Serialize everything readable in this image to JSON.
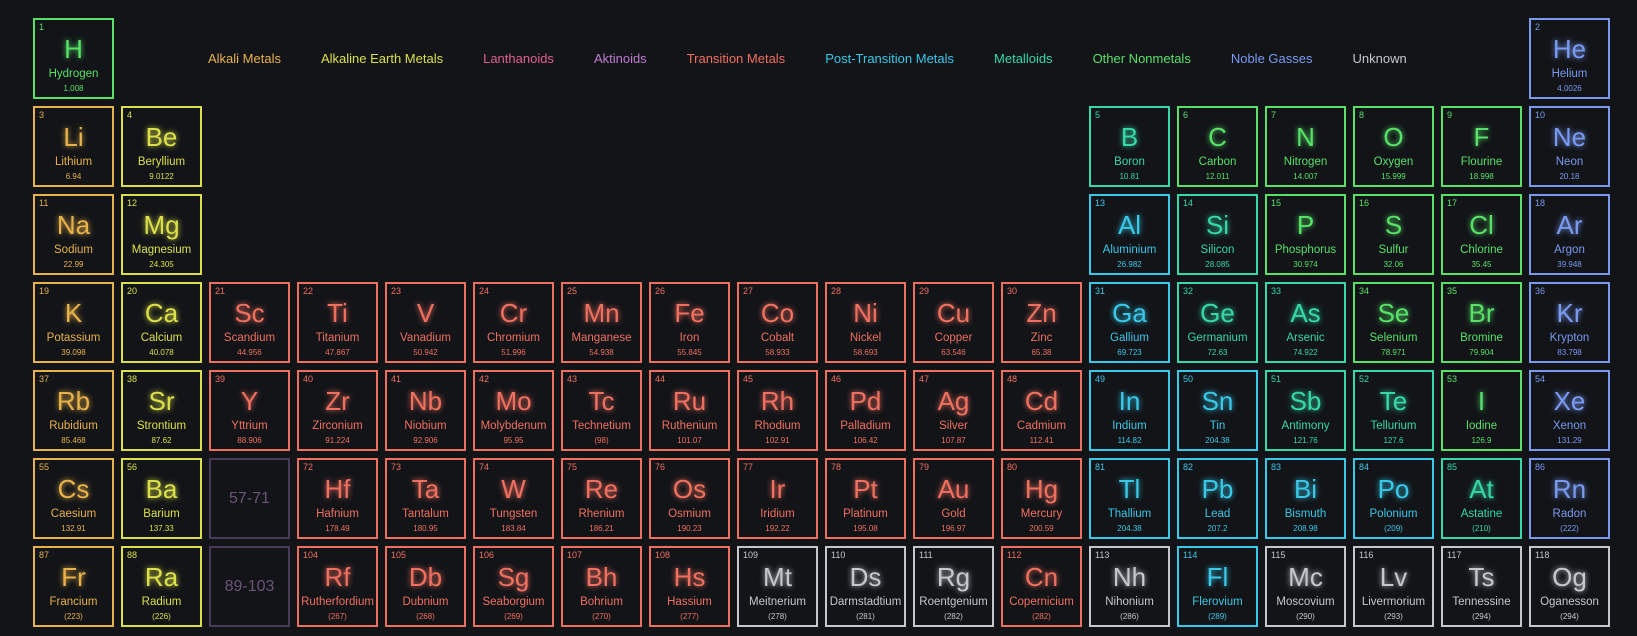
{
  "legend": [
    {
      "key": "alkali",
      "label": "Alkali Metals"
    },
    {
      "key": "alkaline",
      "label": "Alkaline Earth Metals"
    },
    {
      "key": "lanth",
      "label": "Lanthanoids"
    },
    {
      "key": "actin",
      "label": "Aktinoids"
    },
    {
      "key": "trans",
      "label": "Transition Metals"
    },
    {
      "key": "post",
      "label": "Post-Transition Metals"
    },
    {
      "key": "metalloid",
      "label": "Metalloids"
    },
    {
      "key": "nonmetal",
      "label": "Other Nonmetals"
    },
    {
      "key": "noble",
      "label": "Noble Gasses"
    },
    {
      "key": "unknown",
      "label": "Unknown"
    }
  ],
  "placeholders": [
    {
      "label": "57-71",
      "col": 3,
      "row": 6
    },
    {
      "label": "89-103",
      "col": 3,
      "row": 7
    }
  ],
  "elements": [
    {
      "n": "1",
      "s": "H",
      "name": "Hydrogen",
      "w": "1.008",
      "c": "nonmetal",
      "col": 1,
      "row": 1
    },
    {
      "n": "2",
      "s": "He",
      "name": "Helium",
      "w": "4.0026",
      "c": "noble",
      "col": 18,
      "row": 1
    },
    {
      "n": "3",
      "s": "Li",
      "name": "Lithium",
      "w": "6.94",
      "c": "alkali",
      "col": 1,
      "row": 2
    },
    {
      "n": "4",
      "s": "Be",
      "name": "Beryllium",
      "w": "9.0122",
      "c": "alkaline",
      "col": 2,
      "row": 2
    },
    {
      "n": "5",
      "s": "B",
      "name": "Boron",
      "w": "10.81",
      "c": "metalloid",
      "col": 13,
      "row": 2
    },
    {
      "n": "6",
      "s": "C",
      "name": "Carbon",
      "w": "12.011",
      "c": "nonmetal",
      "col": 14,
      "row": 2
    },
    {
      "n": "7",
      "s": "N",
      "name": "Nitrogen",
      "w": "14.007",
      "c": "nonmetal",
      "col": 15,
      "row": 2
    },
    {
      "n": "8",
      "s": "O",
      "name": "Oxygen",
      "w": "15.999",
      "c": "nonmetal",
      "col": 16,
      "row": 2
    },
    {
      "n": "9",
      "s": "F",
      "name": "Flourine",
      "w": "18.998",
      "c": "nonmetal",
      "col": 17,
      "row": 2
    },
    {
      "n": "10",
      "s": "Ne",
      "name": "Neon",
      "w": "20.18",
      "c": "noble",
      "col": 18,
      "row": 2
    },
    {
      "n": "11",
      "s": "Na",
      "name": "Sodium",
      "w": "22.99",
      "c": "alkali",
      "col": 1,
      "row": 3
    },
    {
      "n": "12",
      "s": "Mg",
      "name": "Magnesium",
      "w": "24.305",
      "c": "alkaline",
      "col": 2,
      "row": 3
    },
    {
      "n": "13",
      "s": "Al",
      "name": "Aluminium",
      "w": "26.982",
      "c": "post",
      "col": 13,
      "row": 3
    },
    {
      "n": "14",
      "s": "Si",
      "name": "Silicon",
      "w": "28.085",
      "c": "metalloid",
      "col": 14,
      "row": 3
    },
    {
      "n": "15",
      "s": "P",
      "name": "Phosphorus",
      "w": "30.974",
      "c": "nonmetal",
      "col": 15,
      "row": 3
    },
    {
      "n": "16",
      "s": "S",
      "name": "Sulfur",
      "w": "32.06",
      "c": "nonmetal",
      "col": 16,
      "row": 3
    },
    {
      "n": "17",
      "s": "Cl",
      "name": "Chlorine",
      "w": "35.45",
      "c": "nonmetal",
      "col": 17,
      "row": 3
    },
    {
      "n": "18",
      "s": "Ar",
      "name": "Argon",
      "w": "39.948",
      "c": "noble",
      "col": 18,
      "row": 3
    },
    {
      "n": "19",
      "s": "K",
      "name": "Potassium",
      "w": "39.098",
      "c": "alkali",
      "col": 1,
      "row": 4
    },
    {
      "n": "20",
      "s": "Ca",
      "name": "Calcium",
      "w": "40.078",
      "c": "alkaline",
      "col": 2,
      "row": 4
    },
    {
      "n": "21",
      "s": "Sc",
      "name": "Scandium",
      "w": "44.956",
      "c": "trans",
      "col": 3,
      "row": 4
    },
    {
      "n": "22",
      "s": "Ti",
      "name": "Titanium",
      "w": "47.867",
      "c": "trans",
      "col": 4,
      "row": 4
    },
    {
      "n": "23",
      "s": "V",
      "name": "Vanadium",
      "w": "50.942",
      "c": "trans",
      "col": 5,
      "row": 4
    },
    {
      "n": "24",
      "s": "Cr",
      "name": "Chromium",
      "w": "51.996",
      "c": "trans",
      "col": 6,
      "row": 4
    },
    {
      "n": "25",
      "s": "Mn",
      "name": "Manganese",
      "w": "54.938",
      "c": "trans",
      "col": 7,
      "row": 4
    },
    {
      "n": "26",
      "s": "Fe",
      "name": "Iron",
      "w": "55.845",
      "c": "trans",
      "col": 8,
      "row": 4
    },
    {
      "n": "27",
      "s": "Co",
      "name": "Cobalt",
      "w": "58.933",
      "c": "trans",
      "col": 9,
      "row": 4
    },
    {
      "n": "28",
      "s": "Ni",
      "name": "Nickel",
      "w": "58.693",
      "c": "trans",
      "col": 10,
      "row": 4
    },
    {
      "n": "29",
      "s": "Cu",
      "name": "Copper",
      "w": "63.546",
      "c": "trans",
      "col": 11,
      "row": 4
    },
    {
      "n": "30",
      "s": "Zn",
      "name": "Zinc",
      "w": "65.38",
      "c": "trans",
      "col": 12,
      "row": 4
    },
    {
      "n": "31",
      "s": "Ga",
      "name": "Gallium",
      "w": "69.723",
      "c": "post",
      "col": 13,
      "row": 4
    },
    {
      "n": "32",
      "s": "Ge",
      "name": "Germanium",
      "w": "72.63",
      "c": "metalloid",
      "col": 14,
      "row": 4
    },
    {
      "n": "33",
      "s": "As",
      "name": "Arsenic",
      "w": "74.922",
      "c": "metalloid",
      "col": 15,
      "row": 4
    },
    {
      "n": "34",
      "s": "Se",
      "name": "Selenium",
      "w": "78.971",
      "c": "nonmetal",
      "col": 16,
      "row": 4
    },
    {
      "n": "35",
      "s": "Br",
      "name": "Bromine",
      "w": "79.904",
      "c": "nonmetal",
      "col": 17,
      "row": 4
    },
    {
      "n": "36",
      "s": "Kr",
      "name": "Krypton",
      "w": "83.798",
      "c": "noble",
      "col": 18,
      "row": 4
    },
    {
      "n": "37",
      "s": "Rb",
      "name": "Rubidium",
      "w": "85.468",
      "c": "alkali",
      "col": 1,
      "row": 5
    },
    {
      "n": "38",
      "s": "Sr",
      "name": "Strontium",
      "w": "87.62",
      "c": "alkaline",
      "col": 2,
      "row": 5
    },
    {
      "n": "39",
      "s": "Y",
      "name": "Yttrium",
      "w": "88.906",
      "c": "trans",
      "col": 3,
      "row": 5
    },
    {
      "n": "40",
      "s": "Zr",
      "name": "Zirconium",
      "w": "91.224",
      "c": "trans",
      "col": 4,
      "row": 5
    },
    {
      "n": "41",
      "s": "Nb",
      "name": "Niobium",
      "w": "92.906",
      "c": "trans",
      "col": 5,
      "row": 5
    },
    {
      "n": "42",
      "s": "Mo",
      "name": "Molybdenum",
      "w": "95.95",
      "c": "trans",
      "col": 6,
      "row": 5
    },
    {
      "n": "43",
      "s": "Tc",
      "name": "Technetium",
      "w": "(98)",
      "c": "trans",
      "col": 7,
      "row": 5
    },
    {
      "n": "44",
      "s": "Ru",
      "name": "Ruthenium",
      "w": "101.07",
      "c": "trans",
      "col": 8,
      "row": 5
    },
    {
      "n": "45",
      "s": "Rh",
      "name": "Rhodium",
      "w": "102.91",
      "c": "trans",
      "col": 9,
      "row": 5
    },
    {
      "n": "46",
      "s": "Pd",
      "name": "Palladium",
      "w": "106.42",
      "c": "trans",
      "col": 10,
      "row": 5
    },
    {
      "n": "47",
      "s": "Ag",
      "name": "Silver",
      "w": "107.87",
      "c": "trans",
      "col": 11,
      "row": 5
    },
    {
      "n": "48",
      "s": "Cd",
      "name": "Cadmium",
      "w": "112.41",
      "c": "trans",
      "col": 12,
      "row": 5
    },
    {
      "n": "49",
      "s": "In",
      "name": "Indium",
      "w": "114.82",
      "c": "post",
      "col": 13,
      "row": 5
    },
    {
      "n": "50",
      "s": "Sn",
      "name": "Tin",
      "w": "204.38",
      "c": "post",
      "col": 14,
      "row": 5
    },
    {
      "n": "51",
      "s": "Sb",
      "name": "Antimony",
      "w": "121.76",
      "c": "metalloid",
      "col": 15,
      "row": 5
    },
    {
      "n": "52",
      "s": "Te",
      "name": "Tellurium",
      "w": "127.6",
      "c": "metalloid",
      "col": 16,
      "row": 5
    },
    {
      "n": "53",
      "s": "I",
      "name": "Iodine",
      "w": "126.9",
      "c": "nonmetal",
      "col": 17,
      "row": 5
    },
    {
      "n": "54",
      "s": "Xe",
      "name": "Xenon",
      "w": "131.29",
      "c": "noble",
      "col": 18,
      "row": 5
    },
    {
      "n": "55",
      "s": "Cs",
      "name": "Caesium",
      "w": "132.91",
      "c": "alkali",
      "col": 1,
      "row": 6
    },
    {
      "n": "56",
      "s": "Ba",
      "name": "Barium",
      "w": "137.33",
      "c": "alkaline",
      "col": 2,
      "row": 6
    },
    {
      "n": "72",
      "s": "Hf",
      "name": "Hafnium",
      "w": "178.49",
      "c": "trans",
      "col": 4,
      "row": 6
    },
    {
      "n": "73",
      "s": "Ta",
      "name": "Tantalum",
      "w": "180.95",
      "c": "trans",
      "col": 5,
      "row": 6
    },
    {
      "n": "74",
      "s": "W",
      "name": "Tungsten",
      "w": "183.84",
      "c": "trans",
      "col": 6,
      "row": 6
    },
    {
      "n": "75",
      "s": "Re",
      "name": "Rhenium",
      "w": "186.21",
      "c": "trans",
      "col": 7,
      "row": 6
    },
    {
      "n": "76",
      "s": "Os",
      "name": "Osmium",
      "w": "190.23",
      "c": "trans",
      "col": 8,
      "row": 6
    },
    {
      "n": "77",
      "s": "Ir",
      "name": "Iridium",
      "w": "192.22",
      "c": "trans",
      "col": 9,
      "row": 6
    },
    {
      "n": "78",
      "s": "Pt",
      "name": "Platinum",
      "w": "195.08",
      "c": "trans",
      "col": 10,
      "row": 6
    },
    {
      "n": "79",
      "s": "Au",
      "name": "Gold",
      "w": "196.97",
      "c": "trans",
      "col": 11,
      "row": 6
    },
    {
      "n": "80",
      "s": "Hg",
      "name": "Mercury",
      "w": "200.59",
      "c": "trans",
      "col": 12,
      "row": 6
    },
    {
      "n": "81",
      "s": "Tl",
      "name": "Thallium",
      "w": "204.38",
      "c": "post",
      "col": 13,
      "row": 6
    },
    {
      "n": "82",
      "s": "Pb",
      "name": "Lead",
      "w": "207.2",
      "c": "post",
      "col": 14,
      "row": 6
    },
    {
      "n": "83",
      "s": "Bi",
      "name": "Bismuth",
      "w": "208.98",
      "c": "post",
      "col": 15,
      "row": 6
    },
    {
      "n": "84",
      "s": "Po",
      "name": "Polonium",
      "w": "(209)",
      "c": "post",
      "col": 16,
      "row": 6
    },
    {
      "n": "85",
      "s": "At",
      "name": "Astatine",
      "w": "(210)",
      "c": "metalloid",
      "col": 17,
      "row": 6
    },
    {
      "n": "86",
      "s": "Rn",
      "name": "Radon",
      "w": "(222)",
      "c": "noble",
      "col": 18,
      "row": 6
    },
    {
      "n": "87",
      "s": "Fr",
      "name": "Francium",
      "w": "(223)",
      "c": "alkali",
      "col": 1,
      "row": 7
    },
    {
      "n": "88",
      "s": "Ra",
      "name": "Radium",
      "w": "(226)",
      "c": "alkaline",
      "col": 2,
      "row": 7
    },
    {
      "n": "104",
      "s": "Rf",
      "name": "Rutherfordium",
      "w": "(267)",
      "c": "trans",
      "col": 4,
      "row": 7
    },
    {
      "n": "105",
      "s": "Db",
      "name": "Dubnium",
      "w": "(268)",
      "c": "trans",
      "col": 5,
      "row": 7
    },
    {
      "n": "106",
      "s": "Sg",
      "name": "Seaborgium",
      "w": "(269)",
      "c": "trans",
      "col": 6,
      "row": 7
    },
    {
      "n": "107",
      "s": "Bh",
      "name": "Bohrium",
      "w": "(270)",
      "c": "trans",
      "col": 7,
      "row": 7
    },
    {
      "n": "108",
      "s": "Hs",
      "name": "Hassium",
      "w": "(277)",
      "c": "trans",
      "col": 8,
      "row": 7
    },
    {
      "n": "109",
      "s": "Mt",
      "name": "Meitnerium",
      "w": "(278)",
      "c": "unknown",
      "col": 9,
      "row": 7
    },
    {
      "n": "110",
      "s": "Ds",
      "name": "Darmstadtium",
      "w": "(281)",
      "c": "unknown",
      "col": 10,
      "row": 7
    },
    {
      "n": "111",
      "s": "Rg",
      "name": "Roentgenium",
      "w": "(282)",
      "c": "unknown",
      "col": 11,
      "row": 7
    },
    {
      "n": "112",
      "s": "Cn",
      "name": "Copernicium",
      "w": "(282)",
      "c": "trans",
      "col": 12,
      "row": 7
    },
    {
      "n": "113",
      "s": "Nh",
      "name": "Nihonium",
      "w": "(286)",
      "c": "unknown",
      "col": 13,
      "row": 7
    },
    {
      "n": "114",
      "s": "Fl",
      "name": "Flerovium",
      "w": "(289)",
      "c": "post",
      "col": 14,
      "row": 7
    },
    {
      "n": "115",
      "s": "Mc",
      "name": "Moscovium",
      "w": "(290)",
      "c": "unknown",
      "col": 15,
      "row": 7
    },
    {
      "n": "116",
      "s": "Lv",
      "name": "Livermorium",
      "w": "(293)",
      "c": "unknown",
      "col": 16,
      "row": 7
    },
    {
      "n": "117",
      "s": "Ts",
      "name": "Tennessine",
      "w": "(294)",
      "c": "unknown",
      "col": 17,
      "row": 7
    },
    {
      "n": "118",
      "s": "Og",
      "name": "Oganesson",
      "w": "(294)",
      "c": "unknown",
      "col": 18,
      "row": 7
    }
  ]
}
